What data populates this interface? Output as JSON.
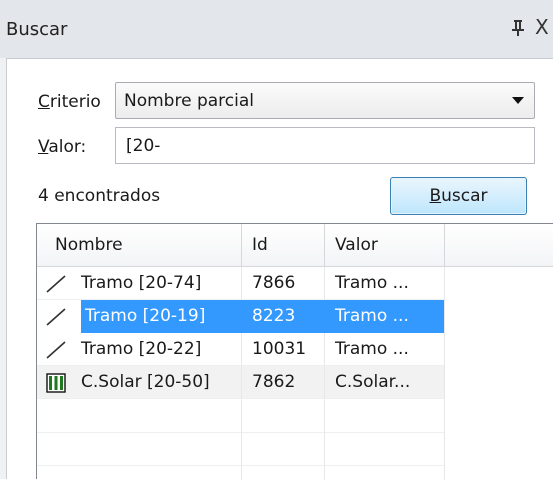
{
  "panel": {
    "title": "Buscar",
    "close_glyph": "X"
  },
  "criterio": {
    "label_u": "C",
    "label_rest": "riterio",
    "selected": "Nombre parcial"
  },
  "valor": {
    "label_u": "V",
    "label_rest": "alor:",
    "value": "[20-"
  },
  "results": {
    "count_text": "4 encontrados",
    "button_u": "B",
    "button_rest": "uscar"
  },
  "table": {
    "headers": [
      "Nombre",
      "Id",
      "Valor"
    ],
    "rows": [
      {
        "icon": "line-segment-icon",
        "nombre": "Tramo [20-74]",
        "id": "7866",
        "valor": "Tramo ..."
      },
      {
        "icon": "line-segment-icon",
        "nombre": "Tramo [20-19]",
        "id": "8223",
        "valor": "Tramo ...",
        "selected": true
      },
      {
        "icon": "line-segment-icon",
        "nombre": "Tramo [20-22]",
        "id": "10031",
        "valor": "Tramo ..."
      },
      {
        "icon": "solar-panel-icon",
        "nombre": "C.Solar [20-50]",
        "id": "7862",
        "valor": "C.Solar..."
      }
    ]
  },
  "colors": {
    "selection": "#3399ff",
    "titlebar": "#e3e6eb",
    "solar_icon": "#1f7a1f"
  }
}
